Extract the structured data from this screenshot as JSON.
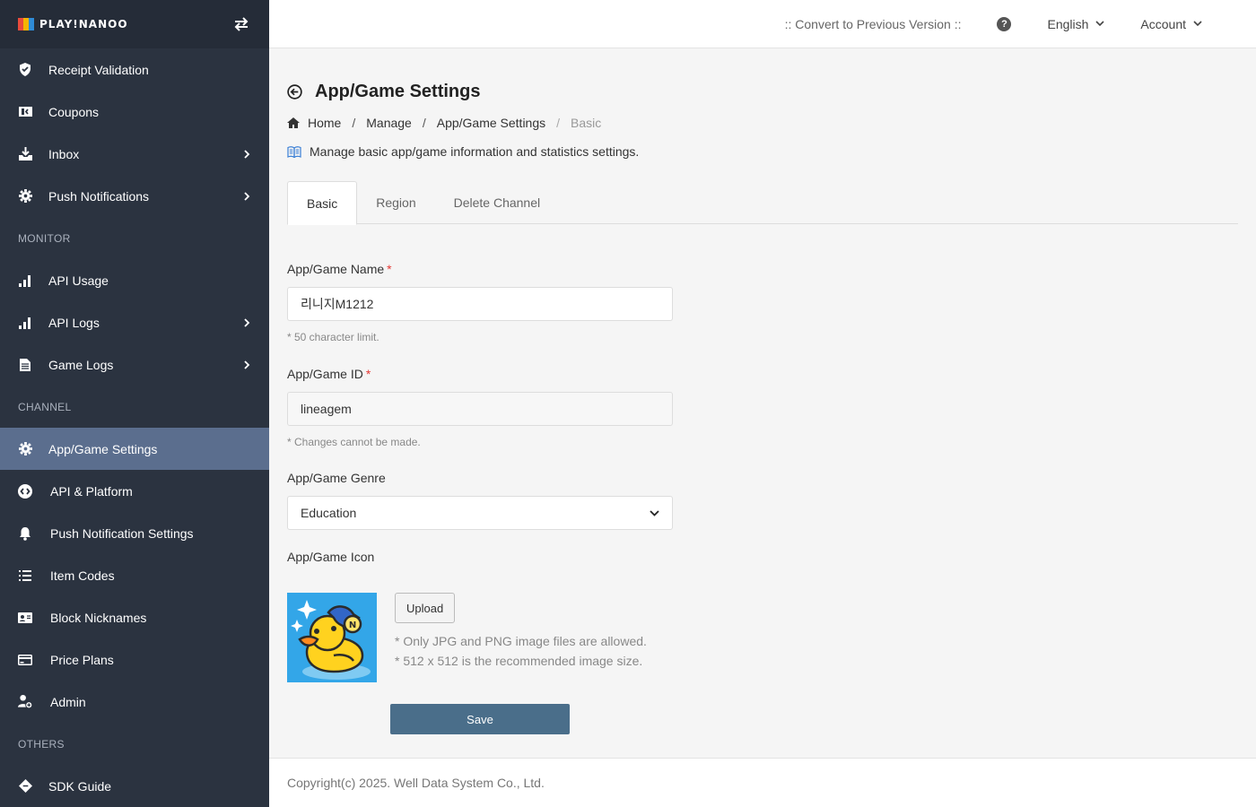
{
  "brand": {
    "logo_text": "PLAY!NANOO"
  },
  "sidebar": {
    "items": [
      {
        "label": "Receipt Validation"
      },
      {
        "label": "Coupons"
      },
      {
        "label": "Inbox"
      },
      {
        "label": "Push Notifications"
      }
    ],
    "sections": {
      "monitor": "MONITOR",
      "channel": "CHANNEL",
      "others": "OTHERS"
    },
    "monitor_items": [
      {
        "label": "API Usage"
      },
      {
        "label": "API Logs"
      },
      {
        "label": "Game Logs"
      }
    ],
    "channel_items": [
      {
        "label": "App/Game Settings"
      },
      {
        "label": "API & Platform"
      },
      {
        "label": "Push Notification Settings"
      },
      {
        "label": "Item Codes"
      },
      {
        "label": "Block Nicknames"
      },
      {
        "label": "Price Plans"
      },
      {
        "label": "Admin"
      }
    ],
    "others_items": [
      {
        "label": "SDK Guide"
      }
    ]
  },
  "topbar": {
    "convert": ":: Convert to Previous Version ::",
    "help": "?",
    "language": "English",
    "account": "Account"
  },
  "page": {
    "title": "App/Game Settings",
    "breadcrumb": [
      "Home",
      "Manage",
      "App/Game Settings",
      "Basic"
    ],
    "breadcrumb_sep": "/",
    "description": "Manage basic app/game information and statistics settings."
  },
  "tabs": [
    {
      "label": "Basic"
    },
    {
      "label": "Region"
    },
    {
      "label": "Delete Channel"
    }
  ],
  "form": {
    "name_label": "App/Game Name",
    "required_mark": "*",
    "name_value": "리니지M1212",
    "name_hint": "* 50 character limit.",
    "id_label": "App/Game ID",
    "id_value": "lineagem",
    "id_hint": "* Changes cannot be made.",
    "genre_label": "App/Game Genre",
    "genre_value": "Education",
    "icon_label": "App/Game Icon",
    "upload_label": "Upload",
    "upload_hint_1": "* Only JPG and PNG image files are allowed.",
    "upload_hint_2": "* 512 x 512 is the recommended image size.",
    "save_label": "Save"
  },
  "footer": {
    "copyright": "Copyright(c) 2025. Well Data System Co., Ltd."
  },
  "colors": {
    "sidebar_bg": "#2b3340",
    "sidebar_active": "#5b6e8e",
    "save_button": "#4a6e8a",
    "required": "#e53935",
    "icon_bg": "#33a6e8"
  }
}
